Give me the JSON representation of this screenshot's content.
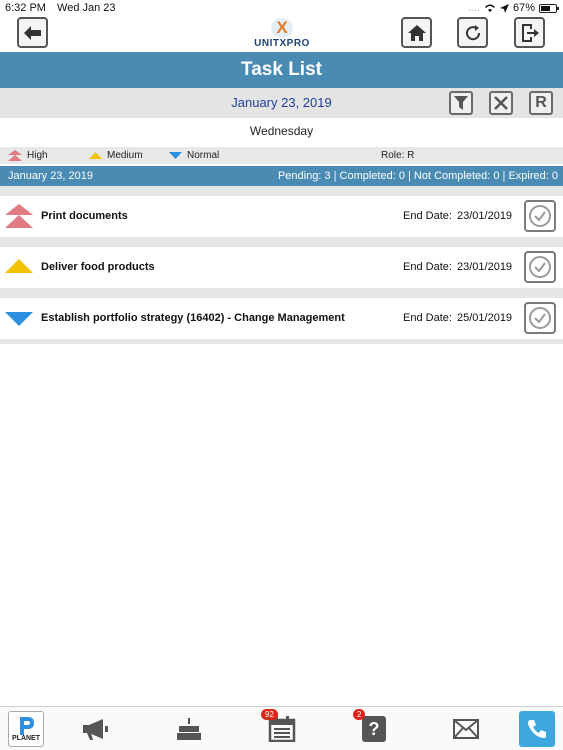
{
  "status_bar": {
    "time": "6:32 PM",
    "date": "Wed Jan 23",
    "battery": "67%",
    "battery_level": 0.67
  },
  "header": {
    "brand": "UNITXPRO",
    "brand_mark": "X"
  },
  "title": "Task List",
  "date_bar": {
    "date": "January 23, 2019",
    "reset_label": "R"
  },
  "weekday": "Wednesday",
  "legend": {
    "high": "High",
    "medium": "Medium",
    "normal": "Normal",
    "role": "Role:  R"
  },
  "info_bar": {
    "date": "January 23, 2019",
    "summary": "Pending: 3 | Completed: 0 | Not Completed: 0 | Expired: 0"
  },
  "end_date_label": "End Date:",
  "tasks": [
    {
      "title": "Print documents",
      "end_date": "23/01/2019",
      "priority": "high"
    },
    {
      "title": "Deliver food products",
      "end_date": "23/01/2019",
      "priority": "medium"
    },
    {
      "title": "Establish portfolio strategy (16402) - Change Management",
      "end_date": "25/01/2019",
      "priority": "normal"
    }
  ],
  "bottom_nav": {
    "planet_label": "PLANET",
    "calendar_badge": "92",
    "help_badge": "2"
  },
  "colors": {
    "primary": "#4a8bb3",
    "high": "#e07a83",
    "medium": "#f2c300",
    "normal": "#2d8fe0"
  }
}
